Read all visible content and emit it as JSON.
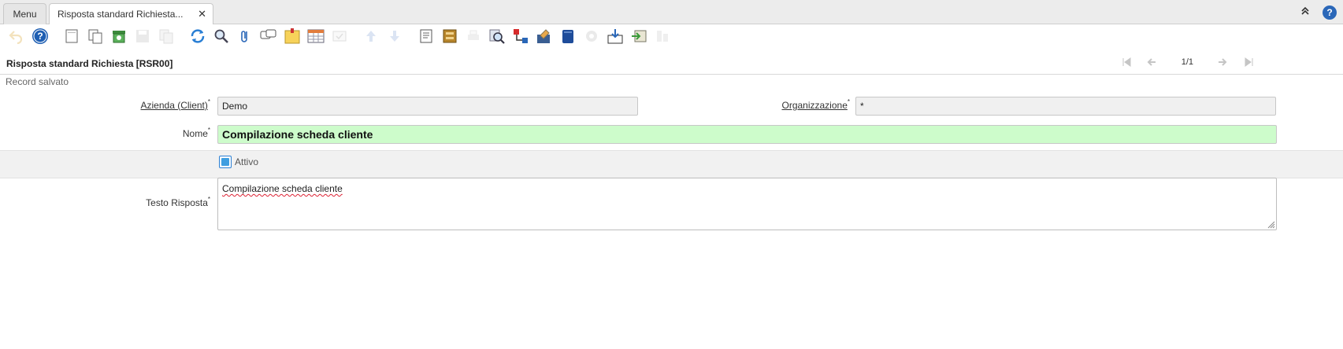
{
  "tabs": {
    "menu_label": "Menu",
    "active_label": "Risposta standard Richiesta...",
    "close_glyph": "✕"
  },
  "tabbar_right": {
    "collapse_glyph": "⌃",
    "help_glyph": "?"
  },
  "toolbar": {
    "icons": [
      "undo-icon",
      "help-icon",
      "new-record-icon",
      "copy-record-icon",
      "delete-record-icon",
      "save-icon",
      "save-and-create-icon",
      "refresh-icon",
      "find-icon",
      "attachment-icon",
      "chat-icon",
      "post-it-icon",
      "grid-toggle-icon",
      "multi-select-icon",
      "parent-record-icon",
      "detail-record-icon",
      "report-icon",
      "archive-icon",
      "print-icon",
      "zoom-across-icon",
      "active-workflows-icon",
      "requests-icon",
      "product-info-icon",
      "process-icon",
      "export-icon",
      "import-icon",
      "customize-icon"
    ]
  },
  "window": {
    "title": "Risposta standard Richiesta [RSR00]",
    "record_indicator": "1/1"
  },
  "status": {
    "message": "Record salvato"
  },
  "form": {
    "client_label": "Azienda (Client)",
    "client_value": "Demo",
    "org_label": "Organizzazione",
    "org_value": "*",
    "name_label": "Nome",
    "name_value": "Compilazione scheda cliente",
    "active_label": "Attivo",
    "active_checked": true,
    "response_label": "Testo Risposta",
    "response_value": "Compilazione scheda cliente",
    "required_marker": "*"
  },
  "colors": {
    "accent": "#2a67b8",
    "name_field_bg": "#cdfccb"
  }
}
